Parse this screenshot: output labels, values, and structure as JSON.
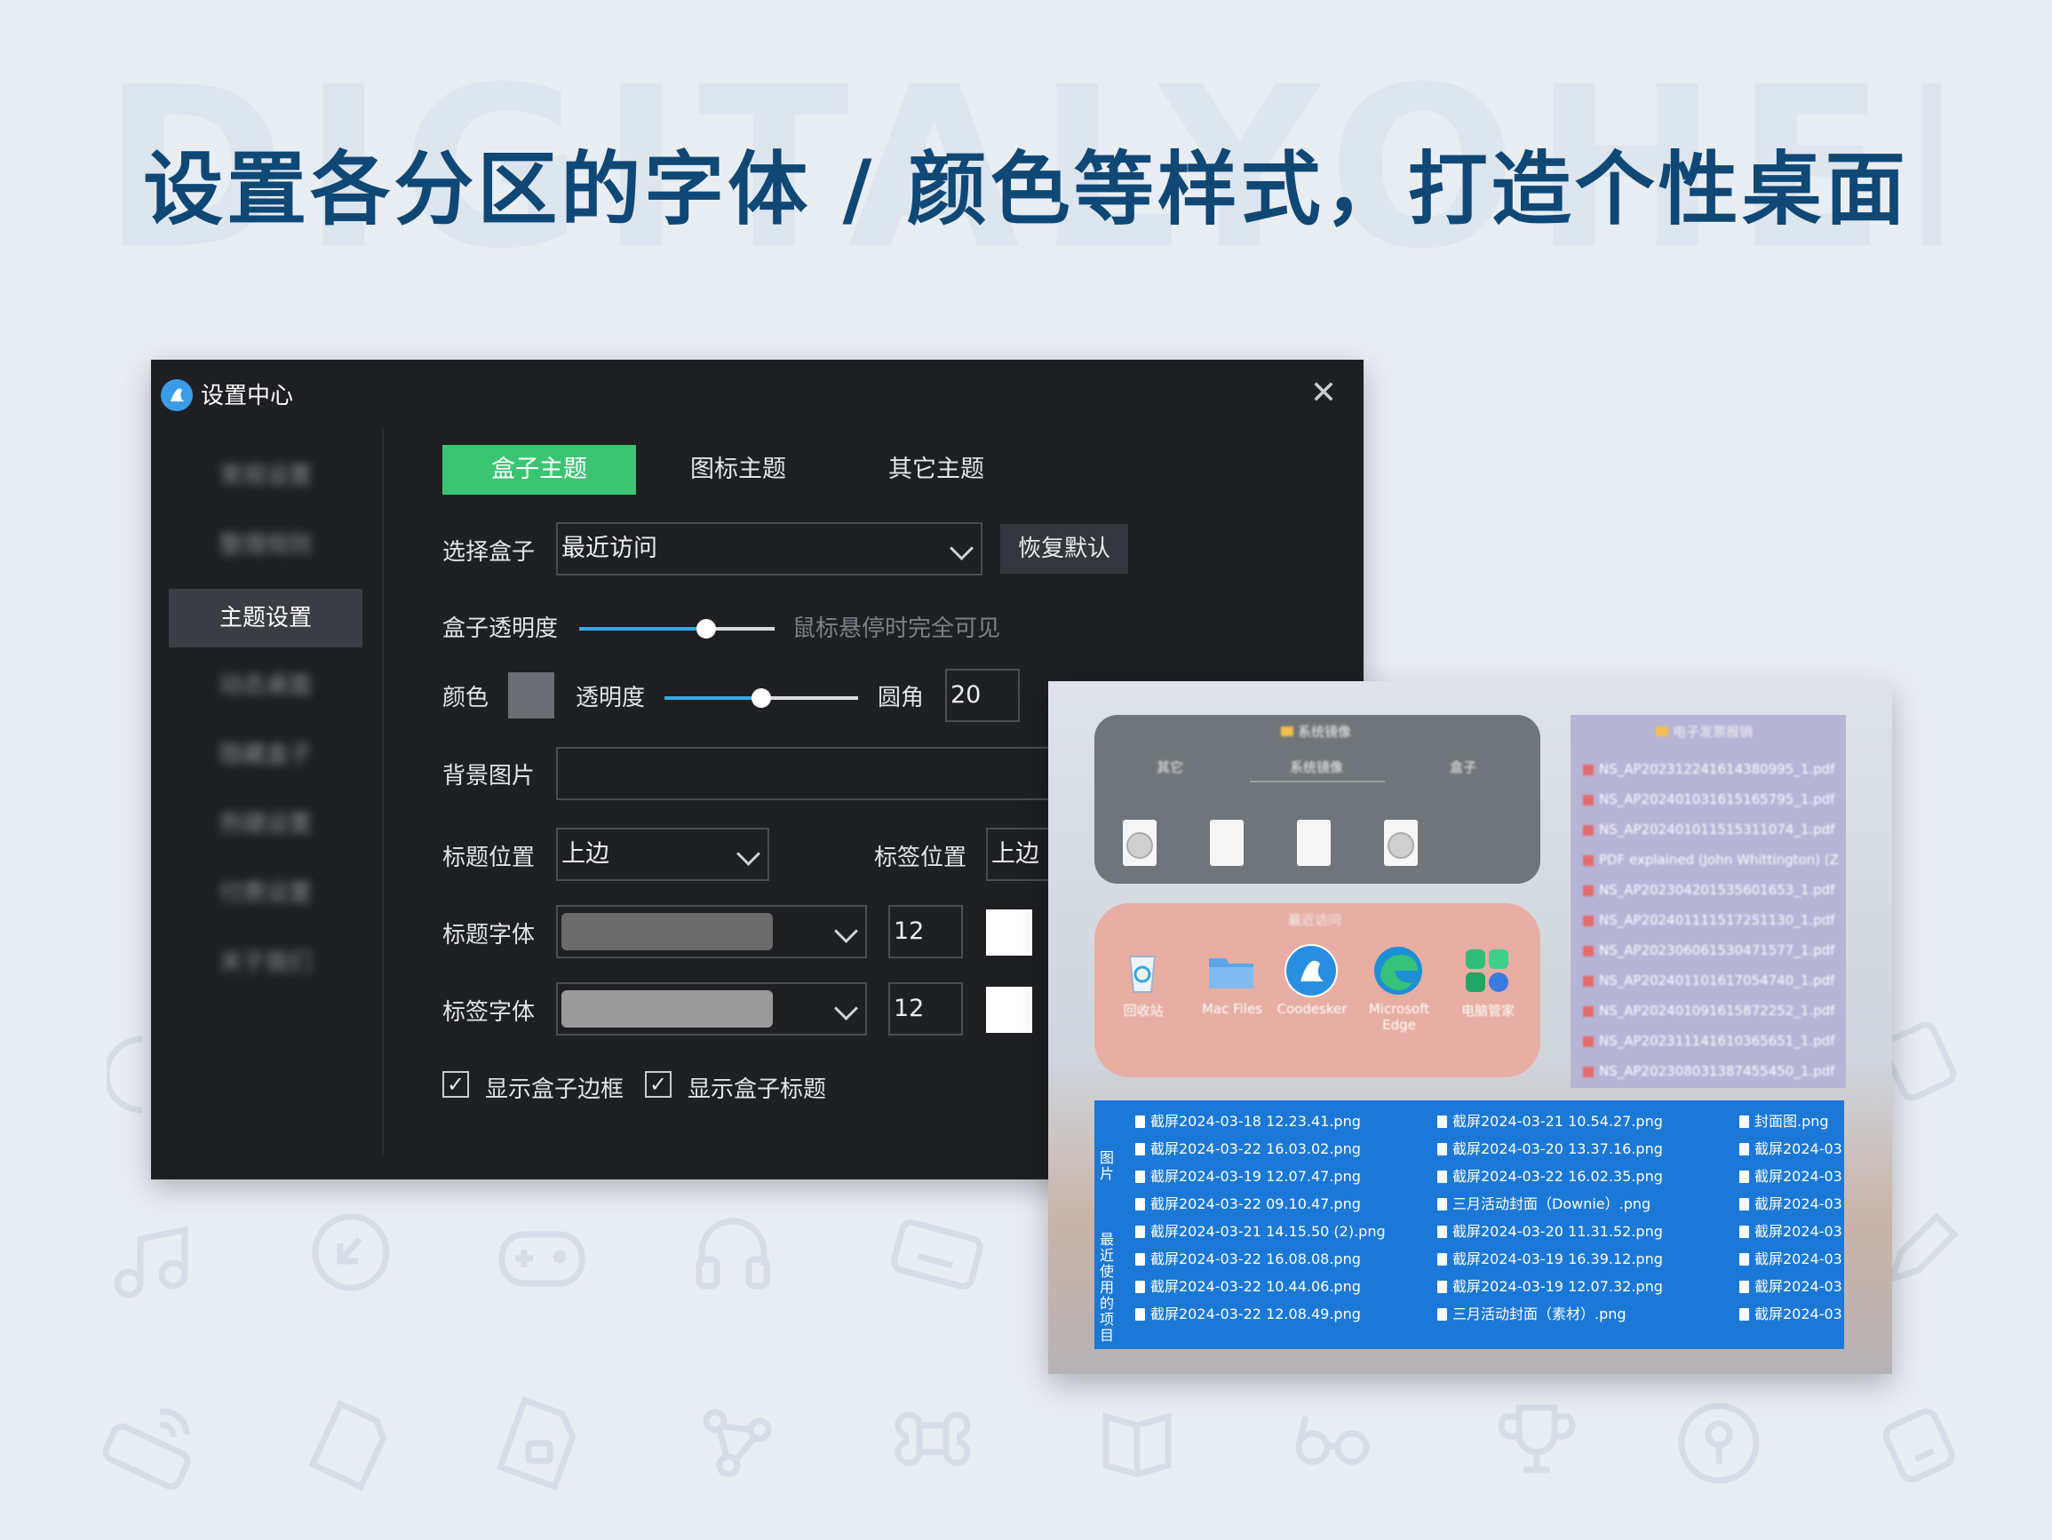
{
  "headline": "设置各分区的字体 / 颜色等样式，打造个性桌面",
  "watermark": "DIGITALYOHEE",
  "colors": {
    "page_bg": "#e9eef3",
    "headline": "#0f4775",
    "window_bg": "#1d1f23",
    "accent_green": "#3dc473",
    "slider_blue": "#3aa8e6",
    "box_gray": "#6f7578",
    "box_pink": "#e8aea3",
    "box_purple": "#b7b5d6",
    "box_blue": "#1b78d6"
  },
  "window": {
    "title": "设置中心",
    "close_icon": "close-icon",
    "sidebar": [
      {
        "label": "常规设置",
        "blurred": true
      },
      {
        "label": "整理规则",
        "blurred": true
      },
      {
        "label": "主题设置",
        "active": true
      },
      {
        "label": "动态桌面",
        "blurred": true
      },
      {
        "label": "隐藏盒子",
        "blurred": true
      },
      {
        "label": "热键设置",
        "blurred": true
      },
      {
        "label": "付费设置",
        "blurred": true
      },
      {
        "label": "关于我们",
        "blurred": true
      }
    ],
    "tabs": [
      "盒子主题",
      "图标主题",
      "其它主题"
    ],
    "select_box": {
      "label": "选择盒子",
      "value": "最近访问",
      "reset_button": "恢复默认"
    },
    "box_opacity": {
      "label": "盒子透明度",
      "value": 0.65,
      "hint": "鼠标悬停时完全可见"
    },
    "color_row": {
      "color_label": "颜色",
      "color_value": "#6a6e73",
      "opacity_label": "透明度",
      "opacity_value": 0.5,
      "radius_label": "圆角",
      "radius_value": "20"
    },
    "background": {
      "label": "背景图片",
      "value": ""
    },
    "title_position": {
      "label": "标题位置",
      "value": "上边",
      "tag_label": "标签位置",
      "tag_value": "上边"
    },
    "title_font": {
      "label": "标题字体",
      "size": "12",
      "preview_color": "#6b6b6b",
      "color": "#ffffff"
    },
    "tag_font": {
      "label": "标签字体",
      "size": "12",
      "preview_color": "#9a9a9a",
      "color": "#ffffff"
    },
    "checkboxes": [
      {
        "label": "显示盒子边框",
        "checked": true
      },
      {
        "label": "显示盒子标题",
        "checked": true
      }
    ]
  },
  "desktop": {
    "gray_box": {
      "title": "系统镜像",
      "tabs": [
        "其它",
        "系统镜像",
        "盒子"
      ],
      "items": [
        "disc",
        "doc",
        "doc",
        "disc"
      ]
    },
    "pink_box": {
      "title": "最近访问",
      "apps": [
        "回收站",
        "Mac Files",
        "Coodesker",
        "Microsoft Edge",
        "电脑管家"
      ]
    },
    "purple_box": {
      "title": "电子发票报销",
      "files": [
        "NS_AP202312241614380995_1.pdf",
        "NS_AP202401031615165795_1.pdf",
        "NS_AP202401011515311074_1.pdf",
        "PDF explained (John Whittington) (Z",
        "NS_AP202304201535601653_1.pdf",
        "NS_AP202401111517251130_1.pdf",
        "NS_AP202306061530471577_1.pdf",
        "NS_AP202401101617054740_1.pdf",
        "NS_AP202401091615872252_1.pdf",
        "NS_AP202311141610365651_1.pdf",
        "NS_AP202308031387455450_1.pdf"
      ]
    },
    "blue_box": {
      "side_labels": [
        "图片",
        "最近使用的项目"
      ],
      "col1": [
        "截屏2024-03-18 12.23.41.png",
        "截屏2024-03-22 16.03.02.png",
        "截屏2024-03-19 12.07.47.png",
        "截屏2024-03-22 09.10.47.png",
        "截屏2024-03-21 14.15.50 (2).png",
        "截屏2024-03-22 16.08.08.png",
        "截屏2024-03-22 10.44.06.png",
        "截屏2024-03-22 12.08.49.png"
      ],
      "col2": [
        "截屏2024-03-21 10.54.27.png",
        "截屏2024-03-20 13.37.16.png",
        "截屏2024-03-22 16.02.35.png",
        "三月活动封面（Downie）.png",
        "截屏2024-03-20 11.31.52.png",
        "截屏2024-03-19 16.39.12.png",
        "截屏2024-03-19 12.07.32.png",
        "三月活动封面（素材）.png"
      ],
      "col3": [
        "封面图.png",
        "截屏2024-03",
        "截屏2024-03",
        "截屏2024-03",
        "截屏2024-03",
        "截屏2024-03",
        "截屏2024-03",
        "截屏2024-03"
      ]
    }
  }
}
